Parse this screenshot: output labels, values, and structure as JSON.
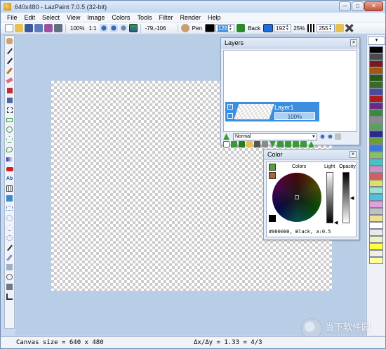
{
  "window": {
    "title": "640x480 - LazPaint 7.0.5 (32-bit)",
    "minimize": "─",
    "maximize": "□",
    "close": "✕"
  },
  "menu": [
    "File",
    "Edit",
    "Select",
    "View",
    "Image",
    "Colors",
    "Tools",
    "Filter",
    "Render",
    "Help"
  ],
  "toolbar": {
    "zoom": "100%",
    "zoom_ratio": "1:1",
    "coords": "-79,-106",
    "pen_label": "Pen",
    "pen_color": "#000000",
    "pen_value": "128",
    "back_label": "Back",
    "back_color": "#1e6ee6",
    "back_value": "192",
    "percent": "25%",
    "opacity_value": "255"
  },
  "layers_panel": {
    "title": "Layers",
    "layer_name": "Layer1",
    "layer_opacity": "100%",
    "blend_mode": "Normal"
  },
  "color_panel": {
    "title": "Color",
    "colors_label": "Colors",
    "light_label": "Light",
    "opacity_label": "Opacity",
    "current_color": "#000000, Black, a:0.5"
  },
  "palette": {
    "swatches": [
      "#000000",
      "#4a4a4a",
      "#7a1a1a",
      "#a05a10",
      "#2a5a10",
      "#3a6a2a",
      "#4a4aa0",
      "#b01a1a",
      "#6a2a8a",
      "#3a8a3a",
      "#8a8a8a",
      "#5aa05a",
      "#2a2a8a",
      "#6aa030",
      "#3a7ad0",
      "#8ac060",
      "#4ac0c0",
      "#d090c0",
      "#d06060",
      "#e0e060",
      "#a0e0d0",
      "#50c0e0",
      "#e0a0e0",
      "#c0c0c0",
      "#f0e090",
      "#ffffff",
      "#e8e8e8",
      "#f0f0c0",
      "#ffff40",
      "#f0f0e0",
      "#ffffa0"
    ]
  },
  "status": {
    "canvas_size": "Canvas size = 640 x 480",
    "ratio": "Δx/Δy = 1.33 = 4/3"
  },
  "watermark": {
    "text_cn": "当下软件园",
    "url": "www.downxia.com"
  }
}
